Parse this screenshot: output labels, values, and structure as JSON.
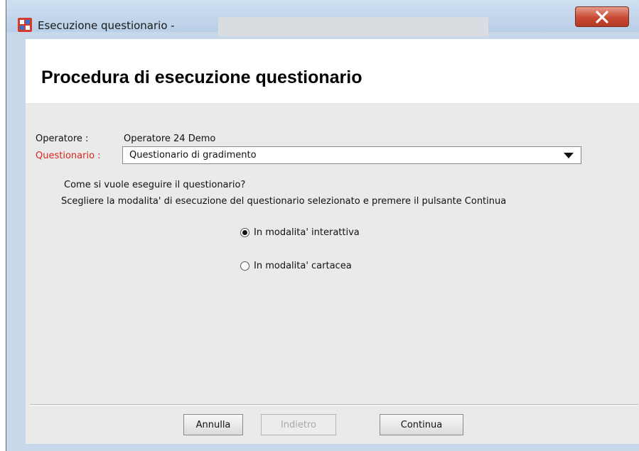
{
  "window": {
    "title": "Esecuzione questionario -",
    "close_glyph": "X",
    "icon": "app-logo-icon",
    "accent_close": "#c84a33"
  },
  "header": {
    "heading": "Procedura di esecuzione questionario"
  },
  "form": {
    "operator_label": "Operatore :",
    "operator_value": "Operatore 24 Demo",
    "questionnaire_label": "Questionario :",
    "questionnaire_value": "Questionario di gradimento",
    "label_color": "#d9261c",
    "question": "Come si vuole eseguire il questionario?",
    "instruction": "Scegliere la modalita' di esecuzione del questionario selezionato  e premere il pulsante Continua"
  },
  "options": [
    {
      "label": "In modalita' interattiva",
      "selected": true
    },
    {
      "label": "In modalita' cartacea",
      "selected": false
    }
  ],
  "buttons": {
    "cancel": "Annulla",
    "back": "Indietro",
    "continue": "Continua"
  }
}
